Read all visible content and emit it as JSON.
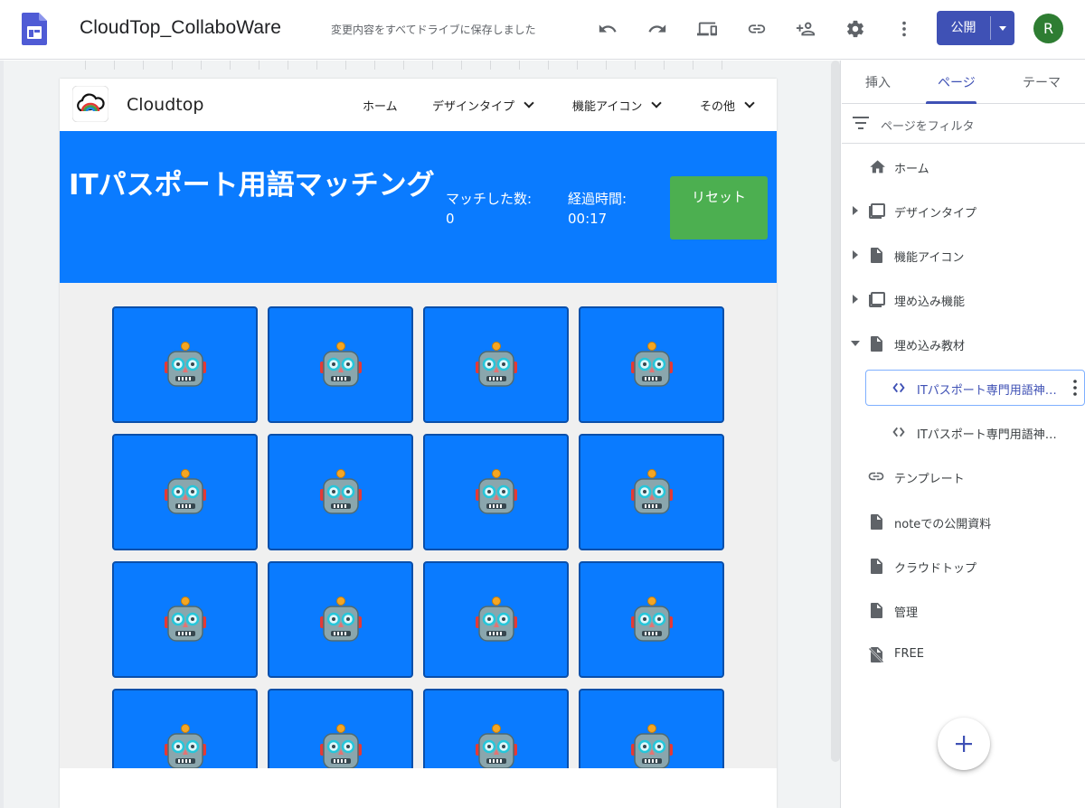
{
  "app": {
    "title": "CloudTop_CollaboWare",
    "save_status": "変更内容をすべてドライブに保存しました",
    "publish_label": "公開",
    "avatar_initial": "R",
    "brand_color": "#3f51b5",
    "toolbar_icons": [
      "undo-icon",
      "redo-icon",
      "preview-icon",
      "link-icon",
      "share-icon",
      "gear-icon",
      "more-vert-icon"
    ]
  },
  "site": {
    "name": "Cloudtop",
    "nav": [
      {
        "label": "ホーム",
        "dropdown": false
      },
      {
        "label": "デザインタイプ",
        "dropdown": true
      },
      {
        "label": "機能アイコン",
        "dropdown": true
      },
      {
        "label": "その他",
        "dropdown": true
      }
    ],
    "banner_color": "#0a7bff",
    "game_title": "ITパスポート用語マッチング",
    "stats": {
      "matches_label": "マッチした数:",
      "matches_value": "0",
      "time_label": "経過時間:",
      "time_value": "00:17"
    },
    "reset_label": "リセット",
    "reset_color": "#4caf50",
    "cards": {
      "face": "robot-face-icon",
      "visible_count": 16
    }
  },
  "panel": {
    "tabs": [
      {
        "label": "挿入",
        "active": false
      },
      {
        "label": "ページ",
        "active": true
      },
      {
        "label": "テーマ",
        "active": false
      }
    ],
    "filter_placeholder": "ページをフィルタ",
    "pages": [
      {
        "label": "ホーム",
        "icon": "home-icon",
        "expand": "none"
      },
      {
        "label": "デザインタイプ",
        "icon": "pages-stack-icon",
        "expand": "collapsed"
      },
      {
        "label": "機能アイコン",
        "icon": "page-icon",
        "expand": "collapsed"
      },
      {
        "label": "埋め込み機能",
        "icon": "pages-stack-icon",
        "expand": "collapsed"
      },
      {
        "label": "埋め込み教材",
        "icon": "page-icon",
        "expand": "expanded"
      },
      {
        "label": "ITパスポート専門用語神経衰弱",
        "icon": "code-icon",
        "expand": "none",
        "sub": true,
        "selected": true
      },
      {
        "label": "ITパスポート専門用語神経衰弱",
        "icon": "code-icon",
        "expand": "none",
        "sub": true
      },
      {
        "label": "テンプレート",
        "icon": "link-icon",
        "expand": "none"
      },
      {
        "label": "noteでの公開資料",
        "icon": "page-icon",
        "expand": "none"
      },
      {
        "label": "クラウドトップ",
        "icon": "page-icon",
        "expand": "none"
      },
      {
        "label": "管理",
        "icon": "page-icon",
        "expand": "none"
      },
      {
        "label": "FREE",
        "icon": "hidden-page-icon",
        "expand": "none"
      }
    ]
  }
}
